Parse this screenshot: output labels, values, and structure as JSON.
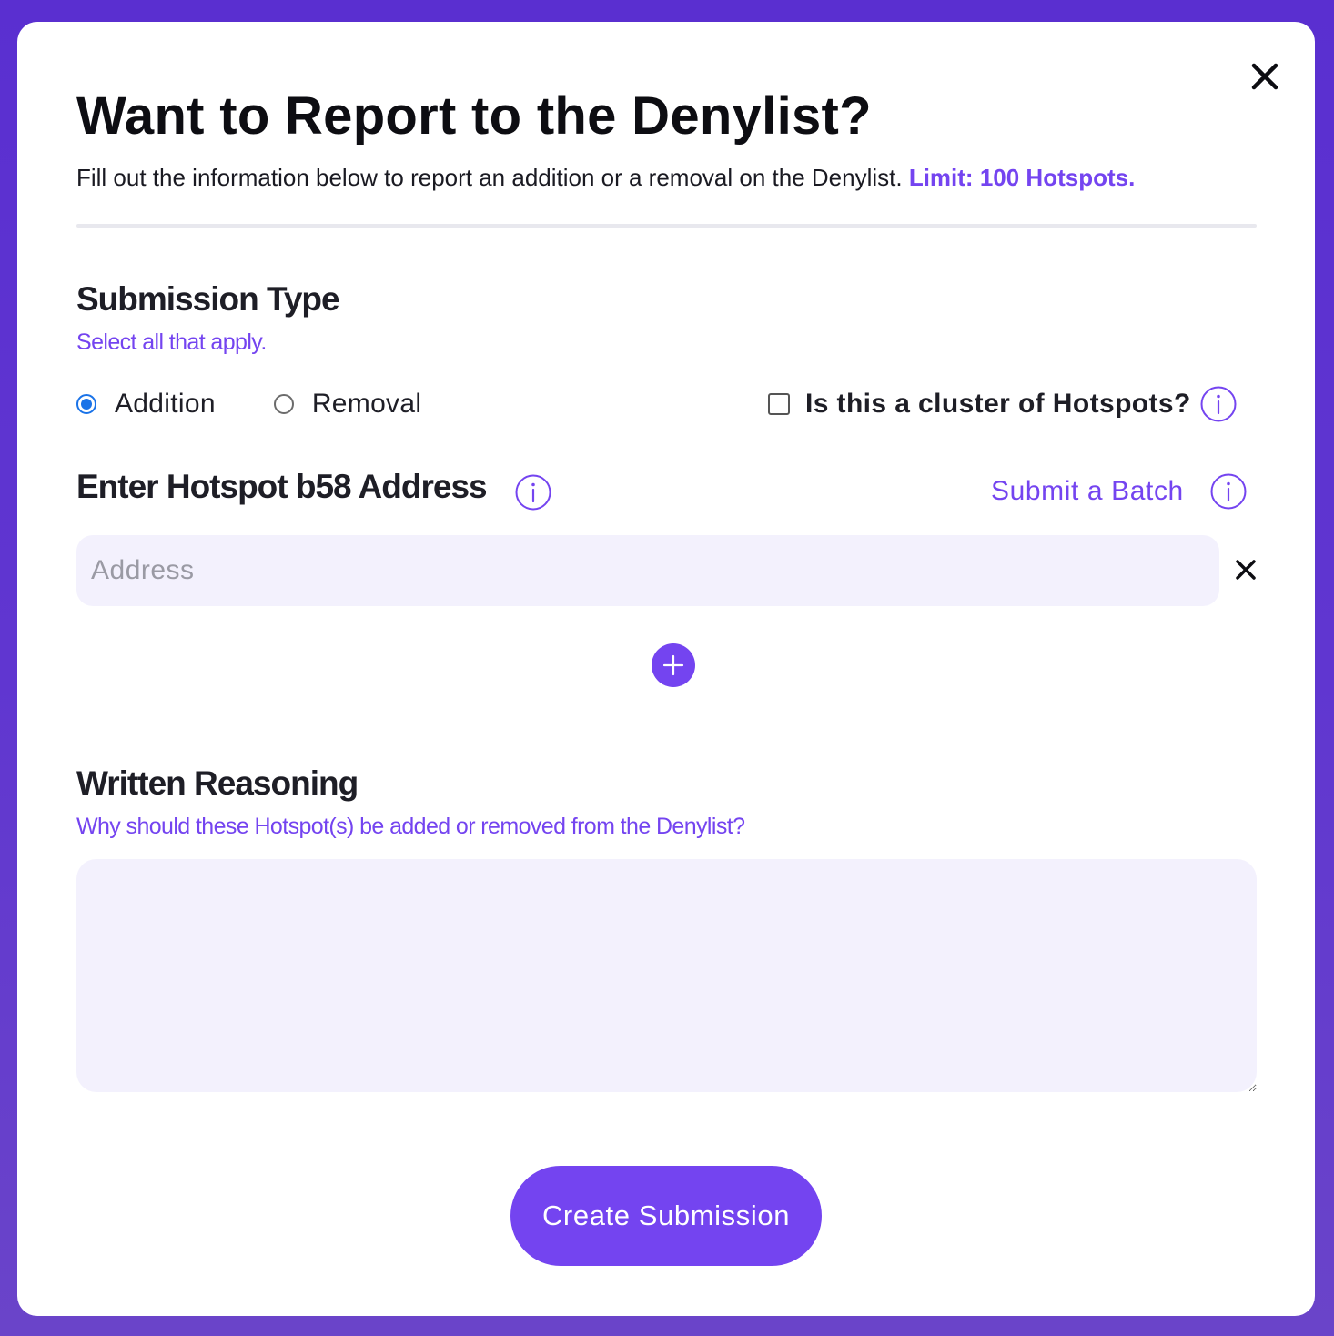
{
  "modal": {
    "title": "Want to Report to the Denylist?",
    "subtitle": "Fill out the information below to report an addition or a removal on the Denylist.",
    "limit_text": "Limit: 100 Hotspots."
  },
  "submission_type": {
    "heading": "Submission Type",
    "hint": "Select all that apply.",
    "options": [
      {
        "label": "Addition",
        "selected": true
      },
      {
        "label": "Removal",
        "selected": false
      }
    ],
    "cluster_label": "Is this a cluster of Hotspots?",
    "cluster_checked": false
  },
  "hotspot": {
    "heading": "Enter Hotspot b58 Address",
    "batch_link": "Submit a Batch",
    "address_placeholder": "Address",
    "address_value": ""
  },
  "reasoning": {
    "heading": "Written Reasoning",
    "hint": "Why should these Hotspot(s) be added or removed from the Denylist?",
    "value": ""
  },
  "actions": {
    "submit_label": "Create Submission"
  },
  "colors": {
    "accent": "#7444f0",
    "background": "#5a2fd0",
    "input_bg": "#f3f1fd",
    "radio_selected": "#1a73e8"
  },
  "icons": {
    "close": "close-icon",
    "info": "info-icon",
    "remove": "close-icon",
    "add": "plus-icon"
  }
}
